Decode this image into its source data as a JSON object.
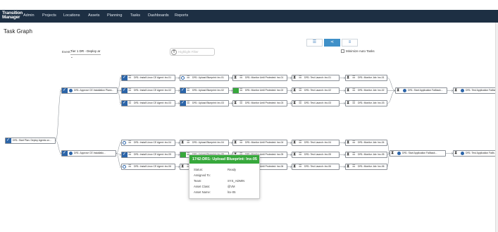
{
  "app": {
    "logo_line1": "Transition",
    "logo_line2": "Manager"
  },
  "nav": [
    {
      "label": "Admin"
    },
    {
      "label": "Projects"
    },
    {
      "label": "Locations"
    },
    {
      "label": "Assets"
    },
    {
      "label": "Planning"
    },
    {
      "label": "Tasks"
    },
    {
      "label": "Dashboards"
    },
    {
      "label": "Reports"
    }
  ],
  "page": {
    "title": "Task Graph"
  },
  "controls": {
    "event_label": "Event:",
    "event_value": "Tier 1 DR - Deploy ar",
    "highlight_placeholder": "Highlight Filter",
    "minimize_label": "Minimize Auto Tasks",
    "view_icons": [
      "list-icon",
      "graph-icon",
      "menu-icon"
    ]
  },
  "nodes": [
    {
      "label": "DR1: Start Plan: Deploy Agents on...",
      "status": "done",
      "icon": "none"
    },
    {
      "label": "DR1: Approve CE Installation Plann...",
      "status": "done",
      "icon": "blue"
    },
    {
      "label": "DR1: Approve CE Installatio...",
      "status": "done",
      "icon": "blue"
    },
    {
      "label": "DR1: Install Linux CE Agent: lnx-01",
      "status": "done",
      "icon": "list"
    },
    {
      "label": "DR1: Install Linux CE Agent: lnx-02",
      "status": "done",
      "icon": "list"
    },
    {
      "label": "DR1: Install Linux CE Agent: lnx-03",
      "status": "done",
      "icon": "list"
    },
    {
      "label": "DR1: Upload Blueprint: lnx-01",
      "status": "ready",
      "icon": "list"
    },
    {
      "label": "DR1: Upload Blueprint: lnx-02",
      "status": "done",
      "icon": "list"
    },
    {
      "label": "DR1: Upload Blueprint: lnx-03",
      "status": "done",
      "icon": "list"
    },
    {
      "label": "DR1: Monitor Until Protected: lnx-01",
      "status": "hold",
      "icon": "list"
    },
    {
      "label": "DR1: Monitor Until Protected: lnx-02",
      "status": "started",
      "icon": "list"
    },
    {
      "label": "DR1: Monitor Until Protected: lnx-03",
      "status": "hold",
      "icon": "list"
    },
    {
      "label": "DR1: Test Launch: lnx-01",
      "status": "hold",
      "icon": "list"
    },
    {
      "label": "DR1: Test Launch: lnx-02",
      "status": "hold",
      "icon": "list"
    },
    {
      "label": "DR1: Test Launch: lnx-03",
      "status": "hold",
      "icon": "list"
    },
    {
      "label": "DR1: Monitor Job: lnx-01",
      "status": "hold",
      "icon": "list"
    },
    {
      "label": "DR1: Monitor Job: lnx-02",
      "status": "hold",
      "icon": "list"
    },
    {
      "label": "DR1: Monitor Job: lnx-03",
      "status": "hold",
      "icon": "list"
    },
    {
      "label": "DR1: Start Application Failback...",
      "status": "hold",
      "icon": "blue"
    },
    {
      "label": "DR1: Test Application Failback...",
      "status": "hold",
      "icon": "blue"
    },
    {
      "label": "DR1: Install Linux CE Agent: lnx-04",
      "status": "ready",
      "icon": "list"
    },
    {
      "label": "DR1: Install Linux CE Agent: lnx-05",
      "status": "done",
      "icon": "list"
    },
    {
      "label": "DR1: Install Linux CE Agent: lnx-06",
      "status": "ready",
      "icon": "list"
    },
    {
      "label": "DR1: Upload Blueprint: lnx-04",
      "status": "hold",
      "icon": "list"
    },
    {
      "label": "DR1: Upload Blueprint: lnx-05",
      "status": "started",
      "icon": "list"
    },
    {
      "label": "DR1: Upload Blueprint: lnx-06",
      "status": "hold",
      "icon": "list"
    },
    {
      "label": "DR1: Monitor Until Protected: lnx-04",
      "status": "hold",
      "icon": "list"
    },
    {
      "label": "DR1: Monitor Until Protected: lnx-05",
      "status": "hold",
      "icon": "list"
    },
    {
      "label": "DR1: Monitor Until Protected: lnx-06",
      "status": "hold",
      "icon": "list"
    },
    {
      "label": "DR1: Test Launch: lnx-04",
      "status": "hold",
      "icon": "list"
    },
    {
      "label": "DR1: Test Launch: lnx-05",
      "status": "hold",
      "icon": "list"
    },
    {
      "label": "DR1: Test Launch: lnx-06",
      "status": "hold",
      "icon": "list"
    },
    {
      "label": "DR1: Monitor Job: lnx-04",
      "status": "hold",
      "icon": "list"
    },
    {
      "label": "DR1: Monitor Job: lnx-05",
      "status": "hold",
      "icon": "list"
    },
    {
      "label": "DR1: Monitor Job: lnx-06",
      "status": "hold",
      "icon": "list"
    },
    {
      "label": "DR1: Start Application Failback...",
      "status": "hold",
      "icon": "blue"
    },
    {
      "label": "DR1: Test Application Failb...",
      "status": "hold",
      "icon": "blue"
    }
  ],
  "tooltip": {
    "title": "1742:DR1: Upload Blueprint: lnx-05",
    "rows": [
      {
        "label": "Status:",
        "value": "Ready"
      },
      {
        "label": "Assigned To:",
        "value": ""
      },
      {
        "label": "Team:",
        "value": "SYS_ADMIN"
      },
      {
        "label": "Asset Class:",
        "value": "@VM"
      },
      {
        "label": "Asset Name:",
        "value": "lnx-05"
      }
    ]
  },
  "colors": {
    "nav": "#1d2f43",
    "done": "#2b64a8",
    "started": "#37a83c"
  }
}
